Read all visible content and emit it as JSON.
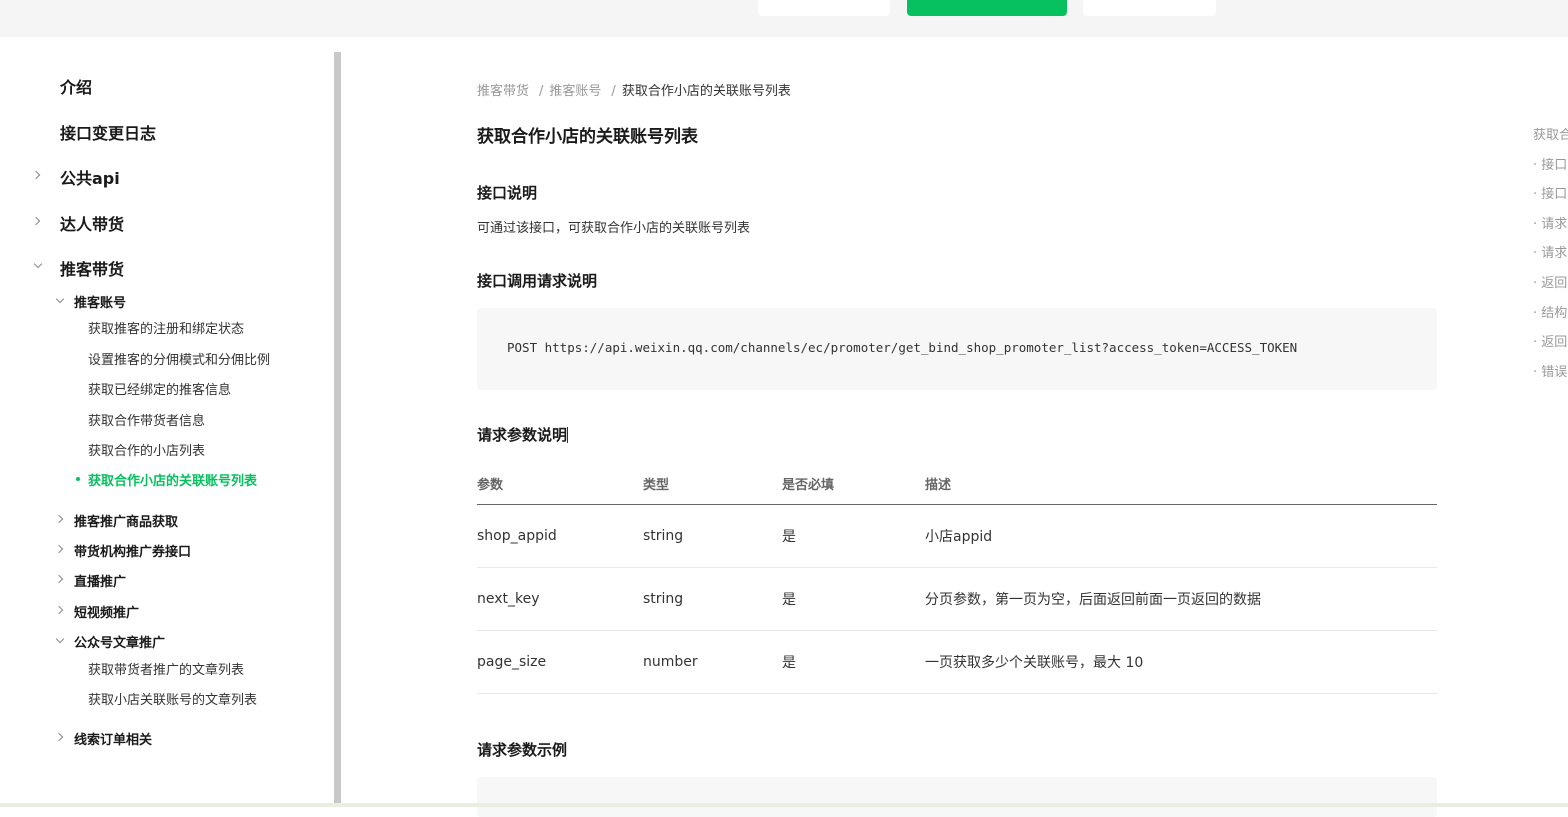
{
  "sidebar": {
    "items": [
      {
        "label": "介绍"
      },
      {
        "label": "接口变更日志"
      },
      {
        "label": "公共api"
      },
      {
        "label": "达人带货"
      },
      {
        "label": "推客带货"
      },
      {
        "label": "推客账号"
      },
      {
        "label": "获取推客的注册和绑定状态"
      },
      {
        "label": "设置推客的分佣模式和分佣比例"
      },
      {
        "label": "获取已经绑定的推客信息"
      },
      {
        "label": "获取合作带货者信息"
      },
      {
        "label": "获取合作的小店列表"
      },
      {
        "label": "获取合作小店的关联账号列表"
      },
      {
        "label": "推客推广商品获取"
      },
      {
        "label": "带货机构推广券接口"
      },
      {
        "label": "直播推广"
      },
      {
        "label": "短视频推广"
      },
      {
        "label": "公众号文章推广"
      },
      {
        "label": "获取带货者推广的文章列表"
      },
      {
        "label": "获取小店关联账号的文章列表"
      },
      {
        "label": "线索订单相关"
      }
    ]
  },
  "breadcrumb": [
    "推客带货",
    "推客账号",
    "获取合作小店的关联账号列表"
  ],
  "page_title": "获取合作小店的关联账号列表",
  "sections": {
    "desc_title": "接口说明",
    "desc_text": "可通过该接口，可获取合作小店的关联账号列表",
    "call_title": "接口调用请求说明",
    "call_code": "POST https://api.weixin.qq.com/channels/ec/promoter/get_bind_shop_promoter_list?access_token=ACCESS_TOKEN",
    "params_title": "请求参数说明",
    "example_title": "请求参数示例"
  },
  "params_table": {
    "headers": [
      "参数",
      "类型",
      "是否必填",
      "描述"
    ],
    "rows": [
      [
        "shop_appid",
        "string",
        "是",
        "小店appid"
      ],
      [
        "next_key",
        "string",
        "是",
        "分页参数，第一页为空，后面返回前面一页返回的数据"
      ],
      [
        "page_size",
        "number",
        "是",
        "一页获取多少个关联账号，最大 10"
      ]
    ]
  },
  "toc": [
    "获取合",
    "· 接口",
    "· 接口",
    "· 请求",
    "· 请求",
    "· 返回",
    "· 结构",
    "· 返回",
    "· 错误"
  ],
  "colors": {
    "accent": "#07c160"
  }
}
